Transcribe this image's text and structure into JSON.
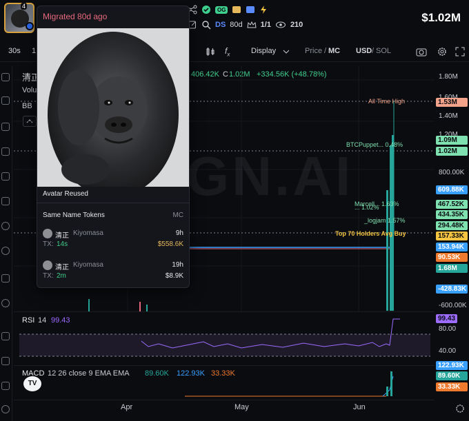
{
  "header": {
    "avatar_count": "4",
    "badge_og": "OG",
    "price": "$1.02M",
    "ds_label": "DS",
    "age": "80d",
    "ratio": "1/1",
    "views": "210"
  },
  "toolbar": {
    "interval": "30s",
    "interval2": "1",
    "display": "Display",
    "price_mc_a": "Price",
    "price_mc_b": "MC",
    "currency_a": "USD",
    "currency_b": "SOL"
  },
  "legend": {
    "symbol": "清正",
    "volume_label": "Volu",
    "bb_label": "BB",
    "ohlc_tail": "406.42K",
    "close_label": "C",
    "close_value": "1.02M",
    "change": "+334.56K (+48.78%)"
  },
  "popup": {
    "title": "Migrated 80d ago",
    "avatar_reused": "Avatar Reused",
    "same_name": "Same Name Tokens",
    "mc_header": "MC",
    "tokens": [
      {
        "name": "清正",
        "sub": "Kiyomasa",
        "age": "9h",
        "tx_label": "TX:",
        "tx_value": "14s",
        "mc": "$558.6K"
      },
      {
        "name": "清正",
        "sub": "Kiyomasa",
        "age": "19h",
        "tx_label": "TX:",
        "tx_value": "2m",
        "mc": "$8.9K"
      }
    ]
  },
  "chart_data": {
    "type": "line",
    "x_ticks": [
      "Apr",
      "May",
      "Jun"
    ],
    "y_ticks": [
      "1.80M",
      "1.60M",
      "1.40M",
      "1.20M",
      "800.00K",
      "-600.00K"
    ],
    "annotations": [
      {
        "text": "All Time High",
        "value": "1.53M"
      },
      {
        "text": "BTCPuppet... 0.48%",
        "value": "1.09M"
      },
      {
        "text": "Marcell... 1.63%",
        "value": "467.52K"
      },
      {
        "text": "... 1.02%",
        "value": "434.35K"
      },
      {
        "text": "_logjam 1.57%",
        "value": "294.48K"
      },
      {
        "text": "Top 70 Holders Avg Buy",
        "value": "157.33K"
      }
    ],
    "price_tags": [
      {
        "value": "1.53M",
        "color": "#f2a38a"
      },
      {
        "value": "1.09M",
        "color": "#7fe0b0"
      },
      {
        "value": "1.02M",
        "color": "#7fe0b0"
      },
      {
        "value": "609.88K",
        "color": "#3aa0ff"
      },
      {
        "value": "467.52K",
        "color": "#7fe0b0"
      },
      {
        "value": "434.35K",
        "color": "#7fe0b0"
      },
      {
        "value": "294.48K",
        "color": "#7fe0b0"
      },
      {
        "value": "157.33K",
        "color": "#f5c542"
      },
      {
        "value": "153.94K",
        "color": "#3aa0ff"
      },
      {
        "value": "90.53K",
        "color": "#f07a2e"
      },
      {
        "value": "1.68M",
        "color": "#26a69a"
      },
      {
        "value": "-428.83K",
        "color": "#3aa0ff"
      }
    ],
    "watermark": "GN.AI",
    "rsi": {
      "label": "RSI",
      "period": "14",
      "value": "99.43",
      "ticks": [
        "80.00",
        "40.00"
      ]
    },
    "macd": {
      "label": "MACD",
      "params": "12 26 close 9 EMA EMA",
      "values": [
        "89.60K",
        "122.93K",
        "33.33K"
      ],
      "tags": [
        {
          "value": "122.93K",
          "color": "#3aa0ff"
        },
        {
          "value": "89.60K",
          "color": "#26a69a"
        },
        {
          "value": "33.33K",
          "color": "#f07a2e"
        }
      ]
    }
  },
  "colors": {
    "accent_green": "#3fcf8e",
    "accent_red": "#e8697d",
    "accent_blue": "#5b8cff"
  }
}
